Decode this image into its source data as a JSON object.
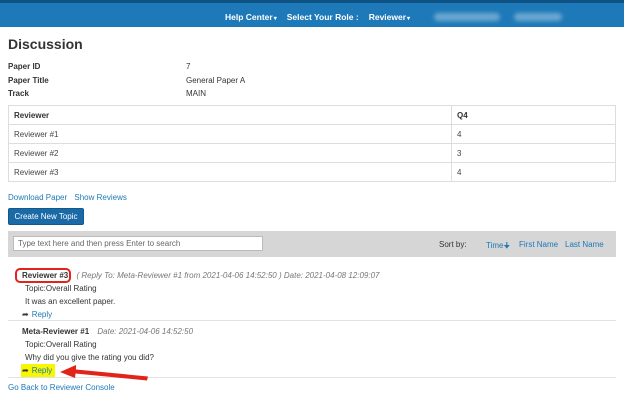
{
  "nav": {
    "help_center": "Help Center",
    "select_role": "Select Your Role :",
    "role": "Reviewer"
  },
  "page": {
    "title": "Discussion"
  },
  "paper": [
    {
      "label": "Paper ID",
      "value": "7"
    },
    {
      "label": "Paper Title",
      "value": "General Paper A"
    },
    {
      "label": "Track",
      "value": "MAIN"
    }
  ],
  "table": {
    "headers": [
      "Reviewer",
      "Q4"
    ],
    "rows": [
      [
        "Reviewer #1",
        "4"
      ],
      [
        "Reviewer #2",
        "3"
      ],
      [
        "Reviewer #3",
        "4"
      ]
    ]
  },
  "links": {
    "download": "Download Paper",
    "show_reviews": "Show Reviews"
  },
  "new_topic_button": "Create New Topic",
  "filter": {
    "placeholder": "Type text here and then press Enter to search",
    "sort_label": "Sort by:",
    "sort_time": "Time",
    "sort_first": "First Name",
    "sort_last": "Last Name"
  },
  "posts": [
    {
      "author": "Reviewer #3",
      "meta": "( Reply To: Meta-Reviewer #1 from 2021-04-06 14:52:50 ) Date: 2021-04-08 12:09:07",
      "topic": "Topic:Overall Rating",
      "body": "It was an excellent paper.",
      "reply": "Reply"
    },
    {
      "author": "Meta-Reviewer #1",
      "meta": "Date: 2021-04-06 14:52:50",
      "topic": "Topic:Overall Rating",
      "body": "Why did you give the rating you did?",
      "reply": "Reply"
    }
  ],
  "back_link": "Go Back to Reviewer Console",
  "colors": {
    "topbar": "#1d79b8",
    "link": "#1d79b8",
    "button": "#1a6aa8",
    "highlight": "#f7f700",
    "annotation": "#e2231a"
  }
}
